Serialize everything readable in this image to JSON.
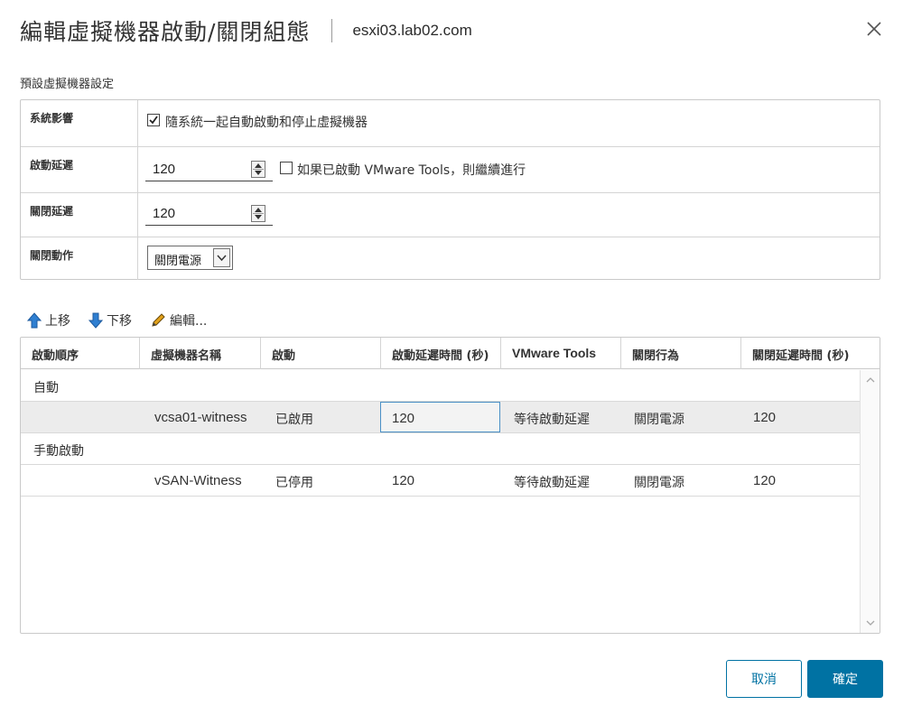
{
  "dialog": {
    "title": "編輯虛擬機器啟動/關閉組態",
    "host": "esxi03.lab02.com"
  },
  "defaults": {
    "section_label": "預設虛擬機器設定",
    "system_impact": {
      "label": "系統影響",
      "checkbox_label": "隨系統一起自動啟動和停止虛擬機器",
      "checked": true
    },
    "start_delay": {
      "label": "啟動延遲",
      "value": "120",
      "checkbox_label": "如果已啟動 VMware Tools，則繼續進行",
      "checked": false
    },
    "stop_delay": {
      "label": "關閉延遲",
      "value": "120"
    },
    "shutdown_action": {
      "label": "關閉動作",
      "selected": "關閉電源"
    }
  },
  "toolbar": {
    "move_up": "上移",
    "move_down": "下移",
    "edit": "編輯..."
  },
  "table": {
    "columns": [
      "啟動順序",
      "虛擬機器名稱",
      "啟動",
      "啟動延遲時間 (秒)",
      "VMware Tools",
      "關閉行為",
      "關閉延遲時間 (秒)"
    ],
    "groups": [
      {
        "name": "自動",
        "rows": [
          {
            "order": "",
            "vm": "vcsa01-witness",
            "startup": "已啟用",
            "start_delay": "120",
            "vmware_tools": "等待啟動延遲",
            "shutdown_behavior": "關閉電源",
            "shutdown_delay": "120"
          }
        ]
      },
      {
        "name": "手動啟動",
        "rows": [
          {
            "order": "",
            "vm": "vSAN-Witness",
            "startup": "已停用",
            "start_delay": "120",
            "vmware_tools": "等待啟動延遲",
            "shutdown_behavior": "關閉電源",
            "shutdown_delay": "120"
          }
        ]
      }
    ]
  },
  "buttons": {
    "cancel": "取消",
    "ok": "確定"
  },
  "colors": {
    "primary": "#0072a3",
    "arrow_blue": "#2f7fd1",
    "selected_row": "#ececec",
    "focus_border": "#4a90c6"
  }
}
